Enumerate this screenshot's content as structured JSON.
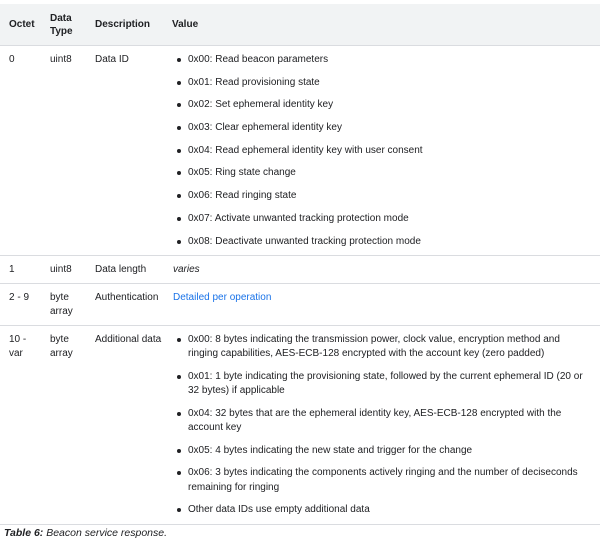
{
  "table": {
    "headers": {
      "octet": "Octet",
      "data_type": "Data Type",
      "description": "Description",
      "value": "Value"
    },
    "rows": [
      {
        "octet": "0",
        "data_type": "uint8",
        "description": "Data ID",
        "values": [
          "0x00: Read beacon parameters",
          "0x01: Read provisioning state",
          "0x02: Set ephemeral identity key",
          "0x03: Clear ephemeral identity key",
          "0x04: Read ephemeral identity key with user consent",
          "0x05: Ring state change",
          "0x06: Read ringing state",
          "0x07: Activate unwanted tracking protection mode",
          "0x08: Deactivate unwanted tracking protection mode"
        ]
      },
      {
        "octet": "1",
        "data_type": "uint8",
        "description": "Data length",
        "value": "varies"
      },
      {
        "octet": "2 - 9",
        "data_type": "byte array",
        "description": "Authentication",
        "link": "Detailed per operation"
      },
      {
        "octet": "10 - var",
        "data_type": "byte array",
        "description": "Additional data",
        "values": [
          "0x00: 8 bytes indicating the transmission power, clock value, encryption method and ringing capabilities, AES-ECB-128 encrypted with the account key (zero padded)",
          "0x01: 1 byte indicating the provisioning state, followed by the current ephemeral ID (20 or 32 bytes) if applicable",
          "0x04: 32 bytes that are the ephemeral identity key, AES-ECB-128 encrypted with the account key",
          "0x05: 4 bytes indicating the new state and trigger for the change",
          "0x06: 3 bytes indicating the components actively ringing and the number of deciseconds remaining for ringing",
          "Other data IDs use empty additional data"
        ]
      }
    ]
  },
  "caption": {
    "label": "Table 6:",
    "text": " Beacon service response."
  },
  "colors": {
    "header_bg": "#f1f3f4",
    "border": "#dadce0",
    "link": "#1a73e8",
    "text": "#202124"
  }
}
